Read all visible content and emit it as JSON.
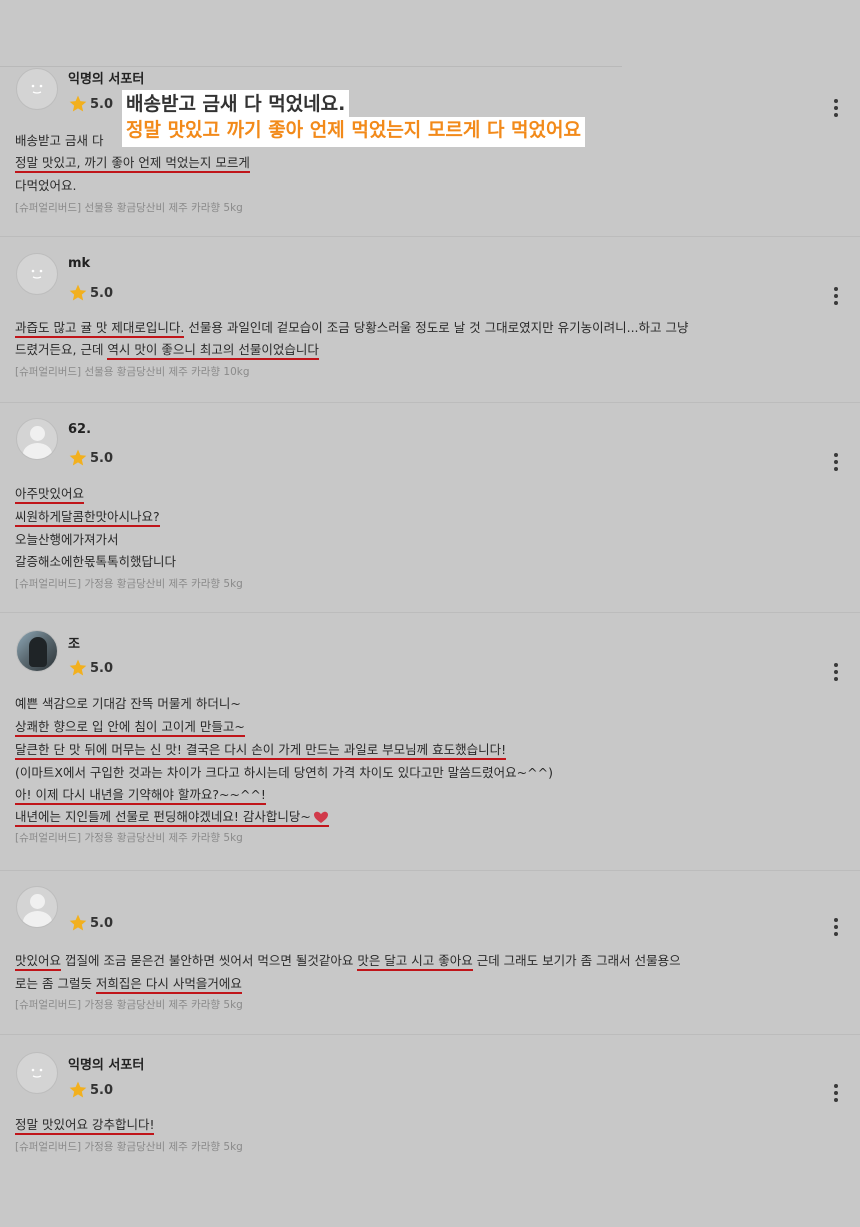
{
  "overlay": {
    "line1": "배송받고 금새 다 먹었네요.",
    "line2": "정말 맛있고 까기 좋아 언제 먹었는지 모르게 다 먹었어요"
  },
  "reviews": [
    {
      "name": "익명의 서포터",
      "rating": "5.0",
      "lines": [
        [
          "배송받고 금새 다"
        ],
        [
          "정말 맛있고, 까기 좋아 언제 먹었는지 모르게"
        ],
        [
          "다먹었어요."
        ]
      ],
      "product": "[슈퍼얼리버드] 선물용 황금당산비 제주 카라향 5kg"
    },
    {
      "name": "mk",
      "rating": "5.0",
      "lines": [
        [
          "과즙도 많고 귤 맛 제대로입니다.",
          " 선물용 과일인데 겉모습이 조금 당황스러울 정도로 날 것 그대로였지만 유기농이려니...하고 그냥"
        ],
        [
          "드렸거든요, 근데 ",
          "역시 맛이 좋으니 최고의 선물이었습니다"
        ]
      ],
      "product": "[슈퍼얼리버드] 선물용 황금당산비 제주 카라향 10kg"
    },
    {
      "name": "62.",
      "rating": "5.0",
      "lines": [
        [
          "아주맛있어요"
        ],
        [
          "씨원하게달콤한맛아시나요?"
        ],
        [
          "오늘산행에가져가서"
        ],
        [
          "갈증해소에한몫톡톡히했답니다"
        ]
      ],
      "product": "[슈퍼얼리버드] 가정용 황금당산비 제주 카라향 5kg"
    },
    {
      "name": "조",
      "rating": "5.0",
      "lines": [
        [
          "예쁜 색감으로 기대감 잔뜩 머물게 하더니~"
        ],
        [
          "상쾌한 향으로 입 안에 침이 고이게 만들고~"
        ],
        [
          "달큰한 단 맛 뒤에 머무는 신 맛! 결국은 다시 손이 가게 만드는 과일로 부모님께 효도했습니다!"
        ],
        [
          "(이마트X에서 구입한 것과는 차이가 크다고 하시는데 당연히 가격 차이도 있다고만 말씀드렸어요~^^)"
        ],
        [
          "아! 이제 다시 내년을 기약해야 할까요?~~^^!"
        ],
        [
          "내년에는 지인들께 선물로 펀딩해야겠네요! 감사합니당~"
        ]
      ],
      "product": "[슈퍼얼리버드] 가정용 황금당산비 제주 카라향 5kg"
    },
    {
      "name": "",
      "rating": "5.0",
      "lines": [
        [
          "맛있어요",
          " 껍질에 조금 묻은건 불안하면 씻어서 먹으면 될것같아요 ",
          "맛은 달고 시고 좋아요",
          " 근데 그래도 보기가 좀 그래서 선물용으"
        ],
        [
          "로는 좀 그럴듯 ",
          "저희집은 다시 사먹을거에요"
        ]
      ],
      "product": "[슈퍼얼리버드] 가정용 황금당산비 제주 카라향 5kg"
    },
    {
      "name": "익명의 서포터",
      "rating": "5.0",
      "lines": [
        [
          "정말 맛있어요 강추합니다!"
        ]
      ],
      "product": "[슈퍼얼리버드] 가정용 황금당산비 제주 카라향 5kg"
    }
  ],
  "colors": {
    "background": "#c8c8c8",
    "underline": "#c0151a",
    "star": "#f2b01e",
    "overlay_accent": "#f28a1a"
  },
  "icons": [
    "star-icon",
    "more-options-icon",
    "anonymous-face-icon",
    "default-avatar-icon",
    "heart-icon"
  ]
}
